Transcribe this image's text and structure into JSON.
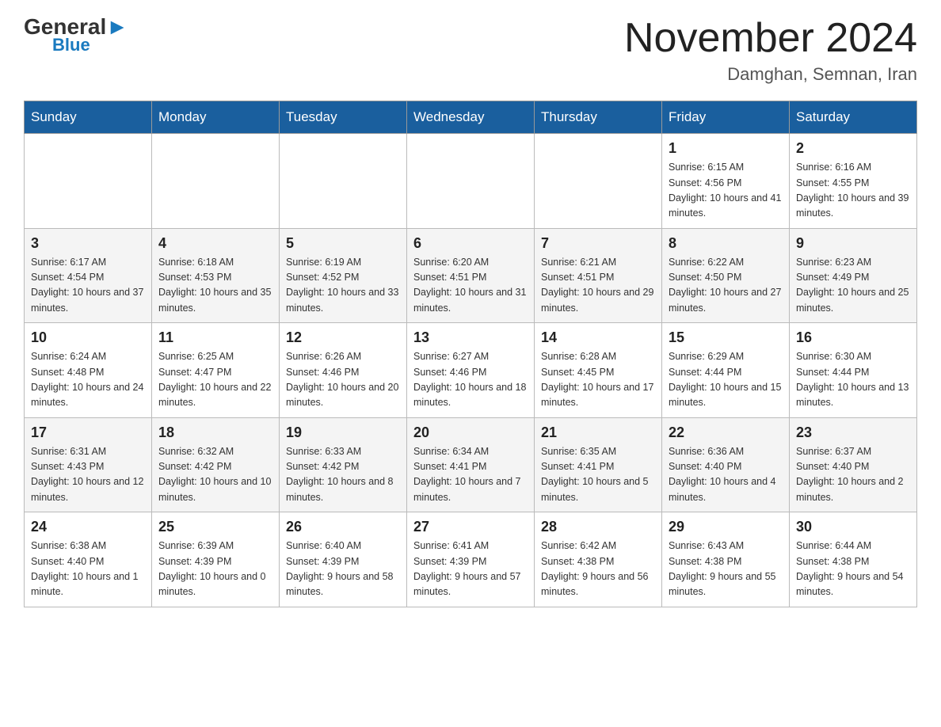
{
  "header": {
    "logo_general": "General",
    "logo_blue": "Blue",
    "month_title": "November 2024",
    "location": "Damghan, Semnan, Iran"
  },
  "days_of_week": [
    "Sunday",
    "Monday",
    "Tuesday",
    "Wednesday",
    "Thursday",
    "Friday",
    "Saturday"
  ],
  "weeks": [
    [
      {
        "day": "",
        "info": ""
      },
      {
        "day": "",
        "info": ""
      },
      {
        "day": "",
        "info": ""
      },
      {
        "day": "",
        "info": ""
      },
      {
        "day": "",
        "info": ""
      },
      {
        "day": "1",
        "info": "Sunrise: 6:15 AM\nSunset: 4:56 PM\nDaylight: 10 hours and 41 minutes."
      },
      {
        "day": "2",
        "info": "Sunrise: 6:16 AM\nSunset: 4:55 PM\nDaylight: 10 hours and 39 minutes."
      }
    ],
    [
      {
        "day": "3",
        "info": "Sunrise: 6:17 AM\nSunset: 4:54 PM\nDaylight: 10 hours and 37 minutes."
      },
      {
        "day": "4",
        "info": "Sunrise: 6:18 AM\nSunset: 4:53 PM\nDaylight: 10 hours and 35 minutes."
      },
      {
        "day": "5",
        "info": "Sunrise: 6:19 AM\nSunset: 4:52 PM\nDaylight: 10 hours and 33 minutes."
      },
      {
        "day": "6",
        "info": "Sunrise: 6:20 AM\nSunset: 4:51 PM\nDaylight: 10 hours and 31 minutes."
      },
      {
        "day": "7",
        "info": "Sunrise: 6:21 AM\nSunset: 4:51 PM\nDaylight: 10 hours and 29 minutes."
      },
      {
        "day": "8",
        "info": "Sunrise: 6:22 AM\nSunset: 4:50 PM\nDaylight: 10 hours and 27 minutes."
      },
      {
        "day": "9",
        "info": "Sunrise: 6:23 AM\nSunset: 4:49 PM\nDaylight: 10 hours and 25 minutes."
      }
    ],
    [
      {
        "day": "10",
        "info": "Sunrise: 6:24 AM\nSunset: 4:48 PM\nDaylight: 10 hours and 24 minutes."
      },
      {
        "day": "11",
        "info": "Sunrise: 6:25 AM\nSunset: 4:47 PM\nDaylight: 10 hours and 22 minutes."
      },
      {
        "day": "12",
        "info": "Sunrise: 6:26 AM\nSunset: 4:46 PM\nDaylight: 10 hours and 20 minutes."
      },
      {
        "day": "13",
        "info": "Sunrise: 6:27 AM\nSunset: 4:46 PM\nDaylight: 10 hours and 18 minutes."
      },
      {
        "day": "14",
        "info": "Sunrise: 6:28 AM\nSunset: 4:45 PM\nDaylight: 10 hours and 17 minutes."
      },
      {
        "day": "15",
        "info": "Sunrise: 6:29 AM\nSunset: 4:44 PM\nDaylight: 10 hours and 15 minutes."
      },
      {
        "day": "16",
        "info": "Sunrise: 6:30 AM\nSunset: 4:44 PM\nDaylight: 10 hours and 13 minutes."
      }
    ],
    [
      {
        "day": "17",
        "info": "Sunrise: 6:31 AM\nSunset: 4:43 PM\nDaylight: 10 hours and 12 minutes."
      },
      {
        "day": "18",
        "info": "Sunrise: 6:32 AM\nSunset: 4:42 PM\nDaylight: 10 hours and 10 minutes."
      },
      {
        "day": "19",
        "info": "Sunrise: 6:33 AM\nSunset: 4:42 PM\nDaylight: 10 hours and 8 minutes."
      },
      {
        "day": "20",
        "info": "Sunrise: 6:34 AM\nSunset: 4:41 PM\nDaylight: 10 hours and 7 minutes."
      },
      {
        "day": "21",
        "info": "Sunrise: 6:35 AM\nSunset: 4:41 PM\nDaylight: 10 hours and 5 minutes."
      },
      {
        "day": "22",
        "info": "Sunrise: 6:36 AM\nSunset: 4:40 PM\nDaylight: 10 hours and 4 minutes."
      },
      {
        "day": "23",
        "info": "Sunrise: 6:37 AM\nSunset: 4:40 PM\nDaylight: 10 hours and 2 minutes."
      }
    ],
    [
      {
        "day": "24",
        "info": "Sunrise: 6:38 AM\nSunset: 4:40 PM\nDaylight: 10 hours and 1 minute."
      },
      {
        "day": "25",
        "info": "Sunrise: 6:39 AM\nSunset: 4:39 PM\nDaylight: 10 hours and 0 minutes."
      },
      {
        "day": "26",
        "info": "Sunrise: 6:40 AM\nSunset: 4:39 PM\nDaylight: 9 hours and 58 minutes."
      },
      {
        "day": "27",
        "info": "Sunrise: 6:41 AM\nSunset: 4:39 PM\nDaylight: 9 hours and 57 minutes."
      },
      {
        "day": "28",
        "info": "Sunrise: 6:42 AM\nSunset: 4:38 PM\nDaylight: 9 hours and 56 minutes."
      },
      {
        "day": "29",
        "info": "Sunrise: 6:43 AM\nSunset: 4:38 PM\nDaylight: 9 hours and 55 minutes."
      },
      {
        "day": "30",
        "info": "Sunrise: 6:44 AM\nSunset: 4:38 PM\nDaylight: 9 hours and 54 minutes."
      }
    ]
  ]
}
